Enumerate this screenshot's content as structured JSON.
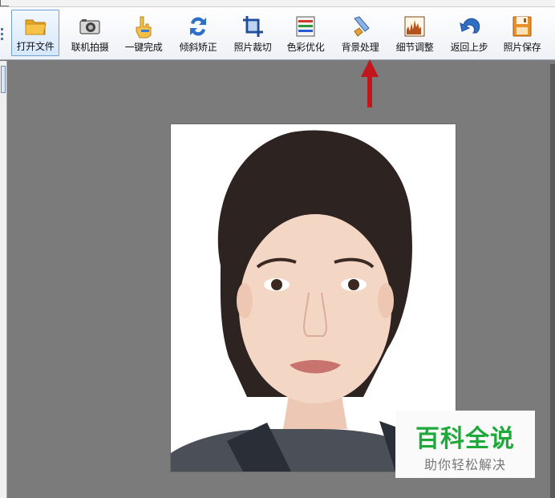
{
  "toolbar": {
    "items": [
      {
        "label": "打开文件",
        "icon": "folder-open-icon",
        "active": true
      },
      {
        "label": "联机拍摄",
        "icon": "camera-icon"
      },
      {
        "label": "一键完成",
        "icon": "hand-pointer-icon"
      },
      {
        "label": "倾斜矫正",
        "icon": "rotate-icon"
      },
      {
        "label": "照片裁切",
        "icon": "crop-icon"
      },
      {
        "label": "色彩优化",
        "icon": "color-adjust-icon"
      },
      {
        "label": "背景处理",
        "icon": "background-brush-icon"
      },
      {
        "label": "细节调整",
        "icon": "histogram-icon"
      },
      {
        "label": "返回上步",
        "icon": "undo-icon"
      },
      {
        "label": "照片保存",
        "icon": "floppy-save-icon"
      }
    ]
  },
  "watermark": {
    "title": "百科全说",
    "subtitle": "助你轻松解决"
  },
  "colors": {
    "workspace": "#7b7b7b",
    "annotation_arrow": "#c0161c",
    "watermark_green": "#1ea93a"
  }
}
